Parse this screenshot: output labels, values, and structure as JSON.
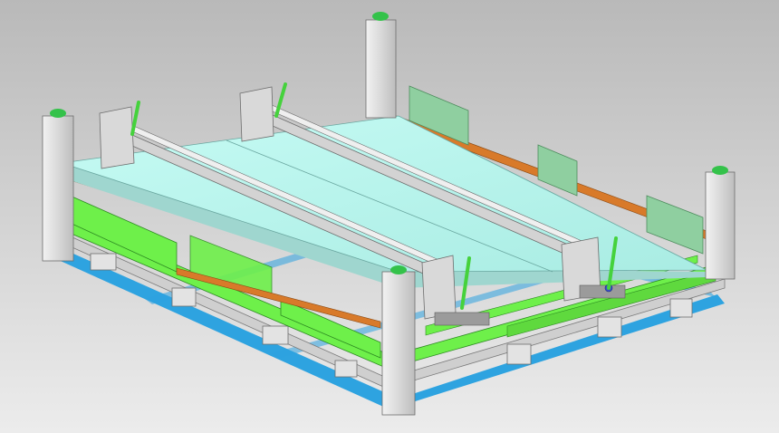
{
  "scene": {
    "kind": "3d-cad-render",
    "subject": "fixture-frame-assembly",
    "colors": {
      "background_top": "#b9b9b9",
      "background_bottom": "#ececec",
      "base_frame": "#2ea3e0",
      "side_rails": "#6ef04a",
      "panel_top": "#bff6ee",
      "panel_edge": "#9fd6cf",
      "orange_rails": "#d87a2a",
      "posts": "#dcdcdc",
      "post_caps": "#34c24a",
      "back_plates": "#8fcfa0",
      "gantry_beams": "#d3d3d3",
      "levers": "#45d23c",
      "dark_metal": "#8a8a8a"
    },
    "icons": [
      "corner-post",
      "gantry-beam",
      "clamp-lever",
      "base-frame"
    ]
  }
}
